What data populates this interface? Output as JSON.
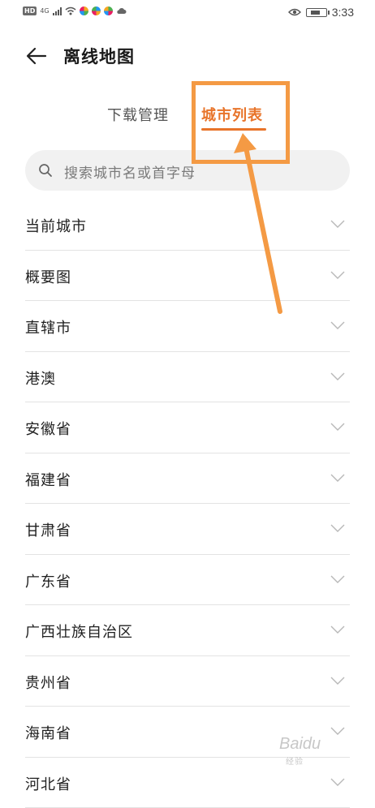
{
  "status_bar": {
    "hd": "HD",
    "signal": "4G",
    "time": "3:33"
  },
  "header": {
    "title": "离线地图"
  },
  "tabs": [
    {
      "label": "下载管理",
      "active": false
    },
    {
      "label": "城市列表",
      "active": true
    }
  ],
  "search": {
    "placeholder": "搜索城市名或首字母"
  },
  "city_list": [
    "当前城市",
    "概要图",
    "直辖市",
    "港澳",
    "安徽省",
    "福建省",
    "甘肃省",
    "广东省",
    "广西壮族自治区",
    "贵州省",
    "海南省",
    "河北省"
  ],
  "watermark": {
    "brand": "Baidu",
    "sub": "经验"
  },
  "colors": {
    "accent": "#e8742a",
    "annotation": "#f49a44"
  }
}
